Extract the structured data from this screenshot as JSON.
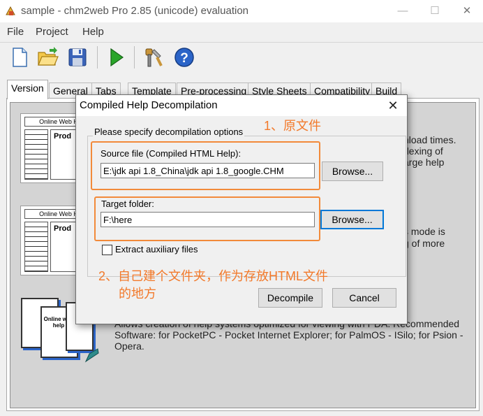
{
  "window": {
    "title": "sample - chm2web Pro 2.85 (unicode) evaluation",
    "minimize": "—",
    "maximize": "☐",
    "close": "✕"
  },
  "menu": [
    "File",
    "Project",
    "Help"
  ],
  "toolbar": {
    "icons": [
      "new-document-icon",
      "open-folder-icon",
      "save-icon",
      "run-icon",
      "tools-icon",
      "help-icon"
    ],
    "help_glyph": "?"
  },
  "tabs": [
    "Version",
    "General",
    "Tabs",
    "Template",
    "Pre-processing",
    "Style Sheets",
    "Compatibility",
    "Build"
  ],
  "background_panel": {
    "thumb_online_web": "Online Web H",
    "thumb_prod": "Prod",
    "text1_lines": [
      "nload times.",
      "dexing of",
      "arge help"
    ],
    "text2_lines": [
      "s mode is",
      "g of more"
    ],
    "pda_thumb_title": "Online web help",
    "text3_lines": [
      "Allows creation of help systems optimized for viewing with PDA. Recommended",
      "Software: for PocketPC - Pocket Internet Explorer; for PalmOS - ISilo; for Psion -",
      "Opera."
    ]
  },
  "dialog": {
    "title": "Compiled Help Decompilation",
    "close": "✕",
    "group_label": "Please specify decompilation options",
    "source_label": "Source file (Compiled HTML Help):",
    "source_value": "E:\\jdk api 1.8_China\\jdk api 1.8_google.CHM",
    "browse1": "Browse...",
    "target_label": "Target folder:",
    "target_value": "F:\\here",
    "browse2": "Browse...",
    "extract_label": "Extract auxiliary files",
    "extract_checked": false,
    "decompile": "Decompile",
    "cancel": "Cancel"
  },
  "annotations": {
    "note1": "1、原文件",
    "note2_line1": "2、自己建个文件夹，作为存放HTML文件",
    "note2_line2": "的地方"
  },
  "colors": {
    "annotation": "#f2792a",
    "focus_blue": "#0078d7",
    "help_icon_blue": "#2b64c8",
    "run_green": "#2aa52a"
  }
}
